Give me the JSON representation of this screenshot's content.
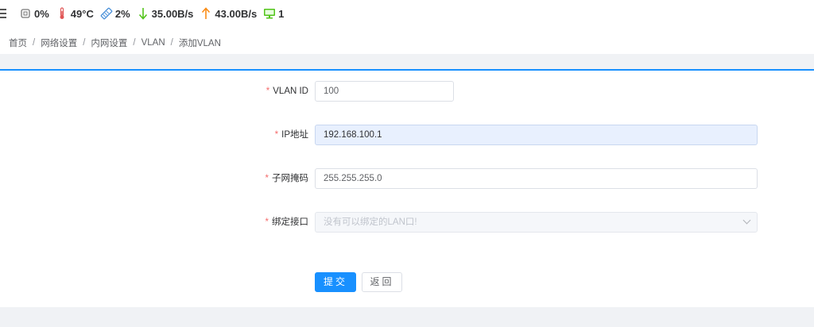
{
  "status_bar": {
    "cpu": "0%",
    "temperature": "49°C",
    "memory": "2%",
    "download": "35.00B/s",
    "upload": "43.00B/s",
    "clients": "1"
  },
  "breadcrumb": {
    "items": [
      "首页",
      "网络设置",
      "内网设置",
      "VLAN",
      "添加VLAN"
    ],
    "separator": "/"
  },
  "form": {
    "required_mark": "*",
    "vlan_id": {
      "label": "VLAN ID",
      "value": "100"
    },
    "ip": {
      "label": "IP地址",
      "value": "192.168.100.1"
    },
    "netmask": {
      "label": "子网掩码",
      "value": "255.255.255.0"
    },
    "bind_iface": {
      "label": "绑定接口",
      "placeholder": "没有可以绑定的LAN口!"
    }
  },
  "buttons": {
    "submit": "提交",
    "back": "返回"
  },
  "colors": {
    "accent": "#1890ff",
    "required": "#f56c6c",
    "temp": "#e05555",
    "down": "#52c41a",
    "up": "#fa8c16",
    "monitor": "#52c41a"
  }
}
